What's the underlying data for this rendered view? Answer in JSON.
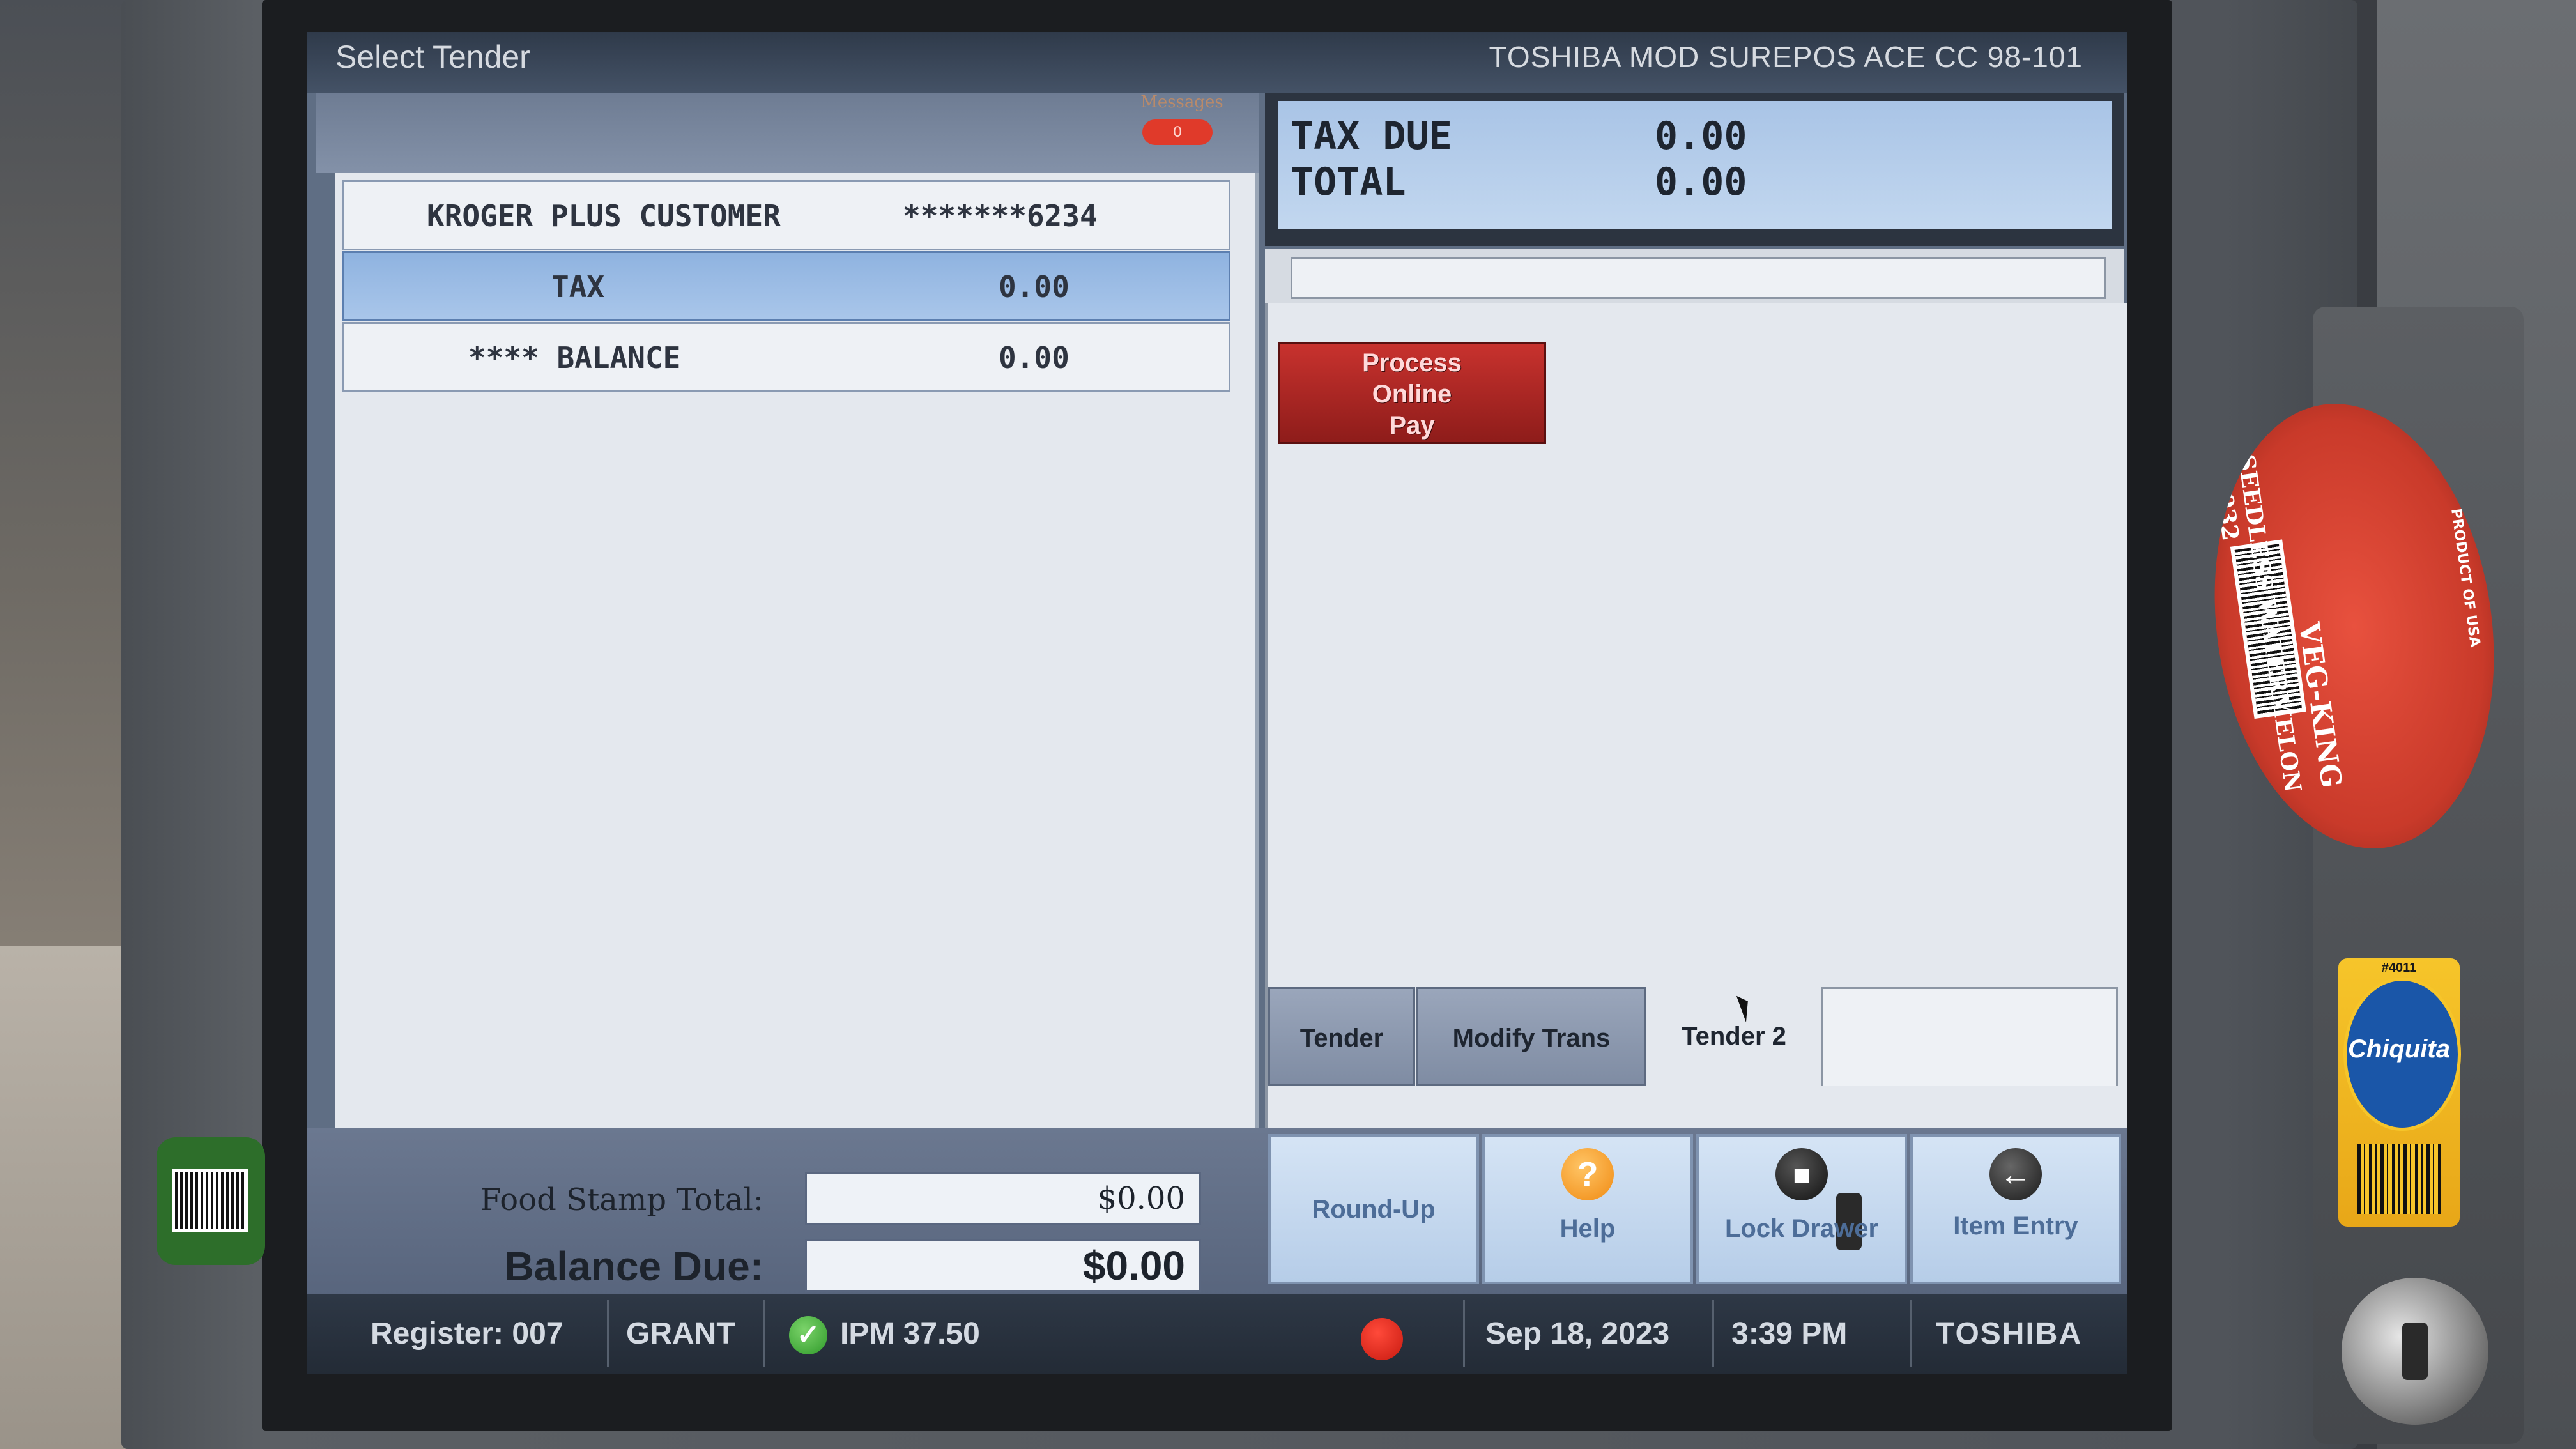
{
  "window": {
    "title": "Select Tender",
    "device_label": "TOSHIBA MOD SUREPOS ACE CC 98-101"
  },
  "messages": {
    "label": "Messages",
    "count": "0"
  },
  "receipt": {
    "rows": [
      {
        "label": "KROGER PLUS CUSTOMER",
        "value": "*******6234",
        "selected": false
      },
      {
        "label": "TAX",
        "value": "0.00",
        "selected": true
      },
      {
        "label": "**** BALANCE",
        "value": "0.00",
        "selected": false
      }
    ]
  },
  "totals": {
    "tax_due_label": "TAX DUE",
    "tax_due_value": "0.00",
    "total_label": "TOTAL",
    "total_value": "0.00"
  },
  "buttons": {
    "process_online_pay": [
      "Process",
      "Online",
      "Pay"
    ]
  },
  "tabs": [
    {
      "label": "Tender",
      "active": false
    },
    {
      "label": "Modify Trans",
      "active": false
    },
    {
      "label": "Tender 2",
      "active": true
    }
  ],
  "summary": {
    "food_stamp_label": "Food Stamp Total:",
    "food_stamp_value": "$0.00",
    "balance_due_label": "Balance Due:",
    "balance_due_value": "$0.00"
  },
  "function_buttons": {
    "round_up": "Round-Up",
    "help": "Help",
    "lock_drawer": "Lock Drawer",
    "item_entry": "Item Entry"
  },
  "status_bar": {
    "register": "Register: 007",
    "operator": "GRANT",
    "ipm": "IPM 37.50",
    "date": "Sep 18, 2023",
    "time": "3:39 PM",
    "brand": "TOSHIBA"
  },
  "stickers": {
    "watermelon_brand": "VEG-KING",
    "watermelon_product": "SEEDLESS WATERMELON #4032",
    "watermelon_origin": "PRODUCT OF USA",
    "banana_brand": "Chiquita",
    "banana_code": "#4011"
  },
  "colors": {
    "selected_row": "#9bbce6",
    "process_button": "#b02a26",
    "status_bar": "#28303c",
    "status_ok": "#3fae36",
    "status_alert": "#e0271a"
  },
  "icons": {
    "help": "question-mark-icon",
    "lock_drawer": "padlock-icon",
    "item_entry": "back-arrow-icon",
    "ipm_status": "checkmark-icon",
    "alert": "red-dot-icon"
  }
}
